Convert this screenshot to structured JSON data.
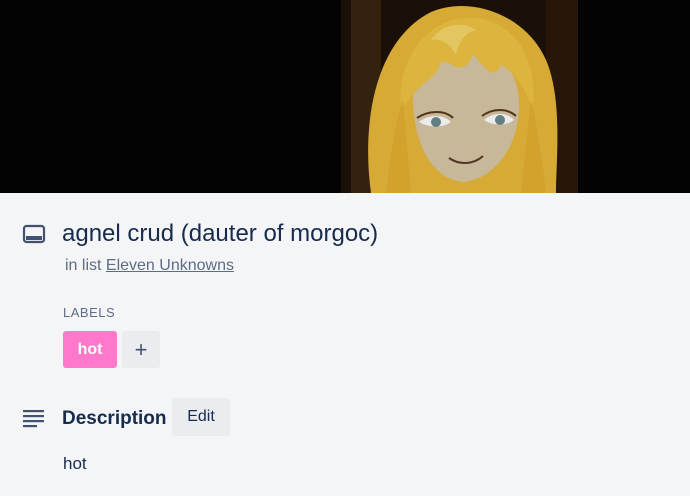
{
  "card": {
    "title": "agnel crud (dauter of morgoc)",
    "list_prefix": "in list",
    "list_name": "Eleven Unknowns"
  },
  "labels": {
    "heading": "LABELS",
    "items": [
      {
        "text": "hot",
        "color": "#ff78cb"
      }
    ],
    "add_symbol": "+"
  },
  "description": {
    "heading": "Description",
    "edit_label": "Edit",
    "text": "hot"
  },
  "icons": {
    "card": "card-icon",
    "description": "description-lines-icon",
    "add": "plus-icon"
  },
  "colors": {
    "panel_background": "#f4f5f7",
    "cover_background": "#030303",
    "text_primary": "#172b4d",
    "text_secondary": "#5e6c84",
    "button_background": "#ebecf0"
  }
}
